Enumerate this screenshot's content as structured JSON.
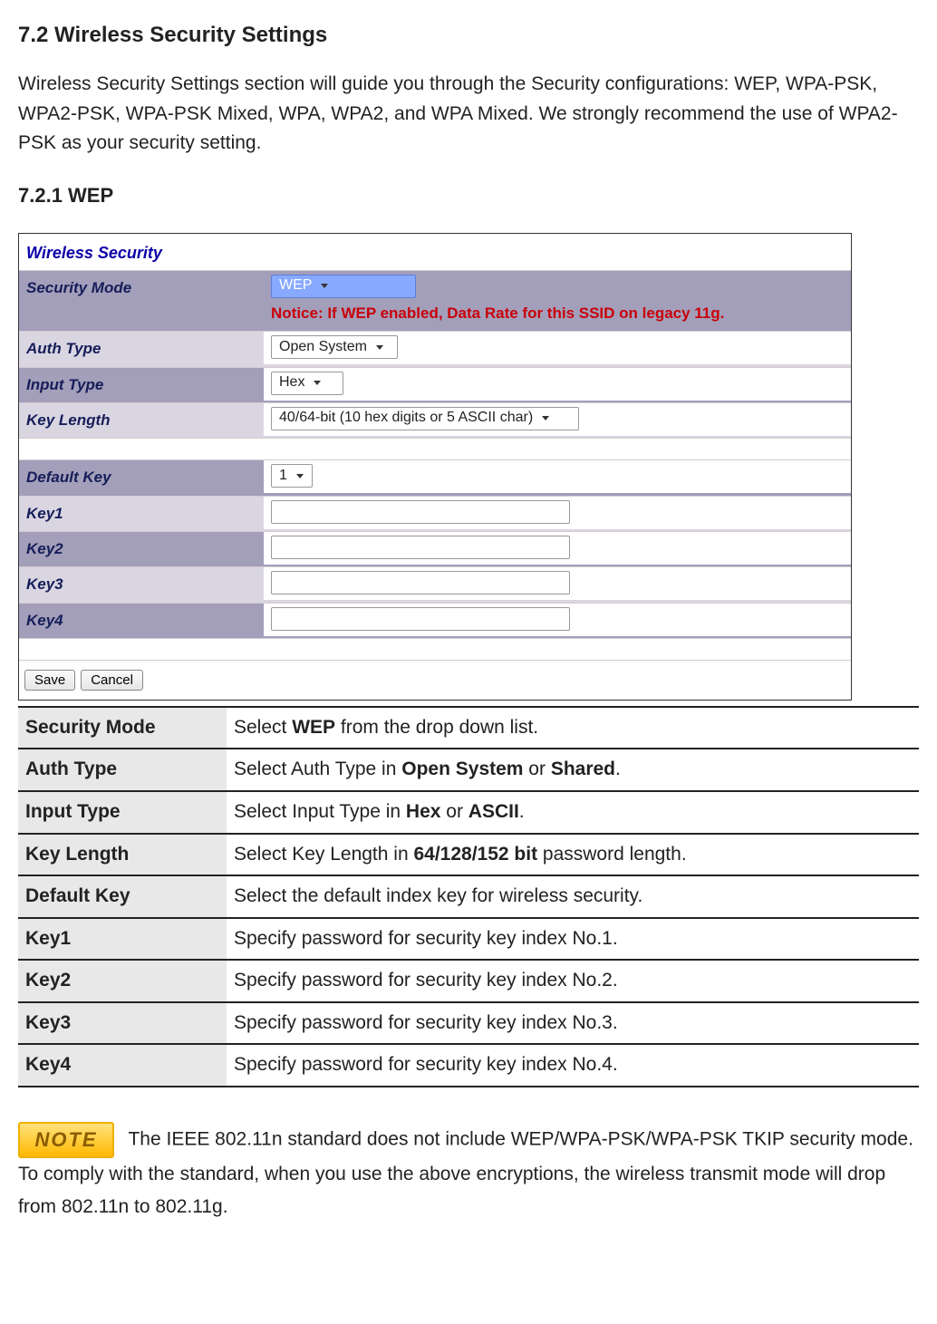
{
  "heading_main": "7.2 Wireless Security Settings",
  "intro_text": "Wireless Security Settings section will guide you through the Security configurations: WEP, WPA-PSK, WPA2-PSK, WPA-PSK Mixed, WPA, WPA2, and WPA Mixed. We strongly recommend the use of WPA2-PSK as your security setting.",
  "heading_sub": "7.2.1 WEP",
  "shot": {
    "panel_title": "Wireless Security",
    "security_mode_label": "Security Mode",
    "security_mode_value": "WEP",
    "notice": "Notice: If WEP enabled, Data Rate for this SSID on legacy 11g.",
    "auth_type_label": "Auth Type",
    "auth_type_value": "Open System",
    "input_type_label": "Input Type",
    "input_type_value": "Hex",
    "key_length_label": "Key Length",
    "key_length_value": "40/64-bit (10 hex digits or 5 ASCII char)",
    "default_key_label": "Default Key",
    "default_key_value": "1",
    "key1_label": "Key1",
    "key2_label": "Key2",
    "key3_label": "Key3",
    "key4_label": "Key4",
    "save_btn": "Save",
    "cancel_btn": "Cancel"
  },
  "desc": {
    "rows": [
      {
        "term": "Security Mode",
        "d_pre": "Select ",
        "d_b": "WEP",
        "d_post": " from the drop down list."
      },
      {
        "term": "Auth Type",
        "d_pre": "Select Auth Type in ",
        "d_b": "Open System",
        "d_mid": " or ",
        "d_b2": "Shared",
        "d_post": "."
      },
      {
        "term": "Input Type",
        "d_pre": "Select Input Type in ",
        "d_b": "Hex",
        "d_mid": " or ",
        "d_b2": "ASCII",
        "d_post": "."
      },
      {
        "term": "Key Length",
        "d_pre": "Select Key Length in ",
        "d_b": "64/128/152 bit",
        "d_post": " password length."
      },
      {
        "term": "Default Key",
        "d_plain": "Select the default index key for wireless security."
      },
      {
        "term": "Key1",
        "d_plain": "Specify password for security key index No.1."
      },
      {
        "term": "Key2",
        "d_plain": "Specify password for security key index No.2."
      },
      {
        "term": "Key3",
        "d_plain": "Specify password for security key index No.3."
      },
      {
        "term": "Key4",
        "d_plain": "Specify password for security key index No.4."
      }
    ]
  },
  "note_badge": "NOTE",
  "note_text": "The IEEE 802.11n standard does not include WEP/WPA-PSK/WPA-PSK TKIP security mode. To comply with the standard, when you use the above encryptions, the wireless transmit mode will drop from 802.11n to 802.11g."
}
